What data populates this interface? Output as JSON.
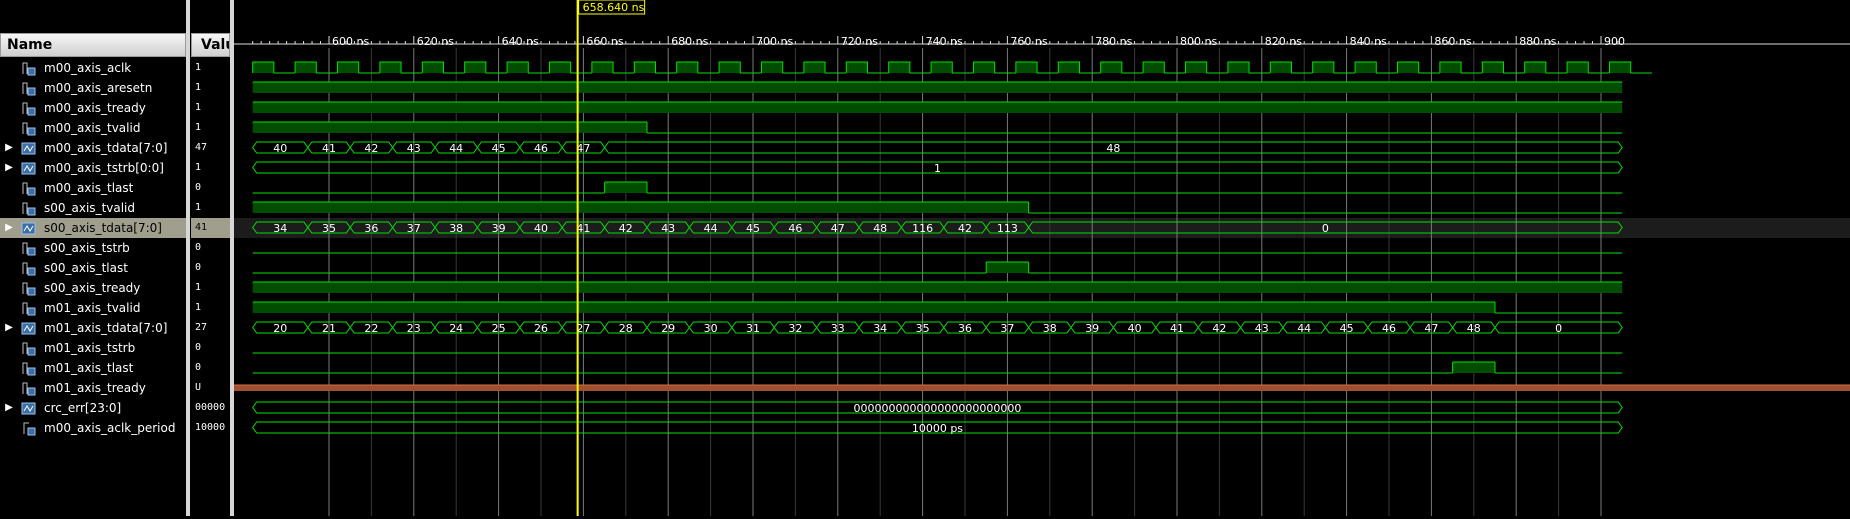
{
  "header": {
    "name_label": "Name",
    "value_label": "Value"
  },
  "cursor": {
    "time_ns": 658.64,
    "label": "658.640 ns"
  },
  "timeline": {
    "tick_labels": [
      {
        "t": 600,
        "label": "600 ns"
      },
      {
        "t": 620,
        "label": "620 ns"
      },
      {
        "t": 640,
        "label": "640 ns"
      },
      {
        "t": 660,
        "label": "660 ns"
      },
      {
        "t": 680,
        "label": "680 ns"
      },
      {
        "t": 700,
        "label": "700 ns"
      },
      {
        "t": 720,
        "label": "720 ns"
      },
      {
        "t": 740,
        "label": "740 ns"
      },
      {
        "t": 760,
        "label": "760 ns"
      },
      {
        "t": 780,
        "label": "780 ns"
      },
      {
        "t": 800,
        "label": "800 ns"
      },
      {
        "t": 820,
        "label": "820 ns"
      },
      {
        "t": 840,
        "label": "840 ns"
      },
      {
        "t": 860,
        "label": "860 ns"
      },
      {
        "t": 880,
        "label": "880 ns"
      },
      {
        "t": 900,
        "label": "900"
      }
    ]
  },
  "colors": {
    "wave": "#00e000",
    "fill": "#004d00",
    "cursor": "#ffff00",
    "undefined": "#a05030",
    "selected": "#a09e8d"
  },
  "signals": [
    {
      "name": "m00_axis_aclk",
      "value": "1",
      "type": "clock",
      "icon": "logic-signal-icon",
      "expandable": false
    },
    {
      "name": "m00_axis_aresetn",
      "value": "1",
      "type": "bit",
      "icon": "logic-signal-icon",
      "expandable": false,
      "segments": [
        {
          "from": 582,
          "to": 905,
          "v": 1
        }
      ]
    },
    {
      "name": "m00_axis_tready",
      "value": "1",
      "type": "bit",
      "icon": "logic-signal-icon",
      "expandable": false,
      "segments": [
        {
          "from": 582,
          "to": 905,
          "v": 1
        }
      ]
    },
    {
      "name": "m00_axis_tvalid",
      "value": "1",
      "type": "bit",
      "icon": "logic-signal-icon",
      "expandable": false,
      "segments": [
        {
          "from": 582,
          "to": 675,
          "v": 1
        },
        {
          "from": 675,
          "to": 905,
          "v": 0
        }
      ]
    },
    {
      "name": "m00_axis_tdata[7:0]",
      "value": "47",
      "type": "bus",
      "icon": "bus-signal-icon",
      "expandable": true,
      "segments": [
        {
          "from": 582,
          "to": 595,
          "v": "40"
        },
        {
          "from": 595,
          "to": 605,
          "v": "41"
        },
        {
          "from": 605,
          "to": 615,
          "v": "42"
        },
        {
          "from": 615,
          "to": 625,
          "v": "43"
        },
        {
          "from": 625,
          "to": 635,
          "v": "44"
        },
        {
          "from": 635,
          "to": 645,
          "v": "45"
        },
        {
          "from": 645,
          "to": 655,
          "v": "46"
        },
        {
          "from": 655,
          "to": 665,
          "v": "47"
        },
        {
          "from": 665,
          "to": 905,
          "v": "48"
        }
      ]
    },
    {
      "name": "m00_axis_tstrb[0:0]",
      "value": "1",
      "type": "bus",
      "icon": "bus-signal-icon",
      "expandable": true,
      "segments": [
        {
          "from": 582,
          "to": 905,
          "v": "1"
        }
      ]
    },
    {
      "name": "m00_axis_tlast",
      "value": "0",
      "type": "bit",
      "icon": "logic-signal-icon",
      "expandable": false,
      "segments": [
        {
          "from": 582,
          "to": 665,
          "v": 0
        },
        {
          "from": 665,
          "to": 675,
          "v": 1
        },
        {
          "from": 675,
          "to": 905,
          "v": 0
        }
      ]
    },
    {
      "name": "s00_axis_tvalid",
      "value": "1",
      "type": "bit",
      "icon": "logic-signal-icon",
      "expandable": false,
      "segments": [
        {
          "from": 582,
          "to": 765,
          "v": 1
        },
        {
          "from": 765,
          "to": 905,
          "v": 0
        }
      ]
    },
    {
      "name": "s00_axis_tdata[7:0]",
      "value": "41",
      "type": "bus",
      "icon": "bus-signal-icon",
      "expandable": true,
      "selected": true,
      "segments": [
        {
          "from": 582,
          "to": 595,
          "v": "34"
        },
        {
          "from": 595,
          "to": 605,
          "v": "35"
        },
        {
          "from": 605,
          "to": 615,
          "v": "36"
        },
        {
          "from": 615,
          "to": 625,
          "v": "37"
        },
        {
          "from": 625,
          "to": 635,
          "v": "38"
        },
        {
          "from": 635,
          "to": 645,
          "v": "39"
        },
        {
          "from": 645,
          "to": 655,
          "v": "40"
        },
        {
          "from": 655,
          "to": 665,
          "v": "41"
        },
        {
          "from": 665,
          "to": 675,
          "v": "42"
        },
        {
          "from": 675,
          "to": 685,
          "v": "43"
        },
        {
          "from": 685,
          "to": 695,
          "v": "44"
        },
        {
          "from": 695,
          "to": 705,
          "v": "45"
        },
        {
          "from": 705,
          "to": 715,
          "v": "46"
        },
        {
          "from": 715,
          "to": 725,
          "v": "47"
        },
        {
          "from": 725,
          "to": 735,
          "v": "48"
        },
        {
          "from": 735,
          "to": 745,
          "v": "116"
        },
        {
          "from": 745,
          "to": 755,
          "v": "42"
        },
        {
          "from": 755,
          "to": 765,
          "v": "113"
        },
        {
          "from": 765,
          "to": 905,
          "v": "0"
        }
      ]
    },
    {
      "name": "s00_axis_tstrb",
      "value": "0",
      "type": "bit",
      "icon": "logic-signal-icon",
      "expandable": false,
      "segments": [
        {
          "from": 582,
          "to": 905,
          "v": 0
        }
      ]
    },
    {
      "name": "s00_axis_tlast",
      "value": "0",
      "type": "bit",
      "icon": "logic-signal-icon",
      "expandable": false,
      "segments": [
        {
          "from": 582,
          "to": 755,
          "v": 0
        },
        {
          "from": 755,
          "to": 765,
          "v": 1
        },
        {
          "from": 765,
          "to": 905,
          "v": 0
        }
      ]
    },
    {
      "name": "s00_axis_tready",
      "value": "1",
      "type": "bit",
      "icon": "logic-signal-icon",
      "expandable": false,
      "segments": [
        {
          "from": 582,
          "to": 905,
          "v": 1
        }
      ]
    },
    {
      "name": "m01_axis_tvalid",
      "value": "1",
      "type": "bit",
      "icon": "logic-signal-icon",
      "expandable": false,
      "segments": [
        {
          "from": 582,
          "to": 875,
          "v": 1
        },
        {
          "from": 875,
          "to": 905,
          "v": 0
        }
      ]
    },
    {
      "name": "m01_axis_tdata[7:0]",
      "value": "27",
      "type": "bus",
      "icon": "bus-signal-icon",
      "expandable": true,
      "segments": [
        {
          "from": 582,
          "to": 595,
          "v": "20"
        },
        {
          "from": 595,
          "to": 605,
          "v": "21"
        },
        {
          "from": 605,
          "to": 615,
          "v": "22"
        },
        {
          "from": 615,
          "to": 625,
          "v": "23"
        },
        {
          "from": 625,
          "to": 635,
          "v": "24"
        },
        {
          "from": 635,
          "to": 645,
          "v": "25"
        },
        {
          "from": 645,
          "to": 655,
          "v": "26"
        },
        {
          "from": 655,
          "to": 665,
          "v": "27"
        },
        {
          "from": 665,
          "to": 675,
          "v": "28"
        },
        {
          "from": 675,
          "to": 685,
          "v": "29"
        },
        {
          "from": 685,
          "to": 695,
          "v": "30"
        },
        {
          "from": 695,
          "to": 705,
          "v": "31"
        },
        {
          "from": 705,
          "to": 715,
          "v": "32"
        },
        {
          "from": 715,
          "to": 725,
          "v": "33"
        },
        {
          "from": 725,
          "to": 735,
          "v": "34"
        },
        {
          "from": 735,
          "to": 745,
          "v": "35"
        },
        {
          "from": 745,
          "to": 755,
          "v": "36"
        },
        {
          "from": 755,
          "to": 765,
          "v": "37"
        },
        {
          "from": 765,
          "to": 775,
          "v": "38"
        },
        {
          "from": 775,
          "to": 785,
          "v": "39"
        },
        {
          "from": 785,
          "to": 795,
          "v": "40"
        },
        {
          "from": 795,
          "to": 805,
          "v": "41"
        },
        {
          "from": 805,
          "to": 815,
          "v": "42"
        },
        {
          "from": 815,
          "to": 825,
          "v": "43"
        },
        {
          "from": 825,
          "to": 835,
          "v": "44"
        },
        {
          "from": 835,
          "to": 845,
          "v": "45"
        },
        {
          "from": 845,
          "to": 855,
          "v": "46"
        },
        {
          "from": 855,
          "to": 865,
          "v": "47"
        },
        {
          "from": 865,
          "to": 875,
          "v": "48"
        },
        {
          "from": 875,
          "to": 905,
          "v": "0"
        }
      ]
    },
    {
      "name": "m01_axis_tstrb",
      "value": "0",
      "type": "bit",
      "icon": "logic-signal-icon",
      "expandable": false,
      "segments": [
        {
          "from": 582,
          "to": 905,
          "v": 0
        }
      ]
    },
    {
      "name": "m01_axis_tlast",
      "value": "0",
      "type": "bit",
      "icon": "logic-signal-icon",
      "expandable": false,
      "segments": [
        {
          "from": 582,
          "to": 865,
          "v": 0
        },
        {
          "from": 865,
          "to": 875,
          "v": 1
        },
        {
          "from": 875,
          "to": 905,
          "v": 0
        }
      ]
    },
    {
      "name": "m01_axis_tready",
      "value": "U",
      "type": "undefined",
      "icon": "logic-signal-icon",
      "expandable": false,
      "segments": [
        {
          "from": 582,
          "to": 905,
          "v": "U"
        }
      ]
    },
    {
      "name": "crc_err[23:0]",
      "value": "00000",
      "type": "bus",
      "icon": "bus-signal-icon",
      "expandable": true,
      "segments": [
        {
          "from": 582,
          "to": 905,
          "v": "000000000000000000000000"
        }
      ]
    },
    {
      "name": "m00_axis_aclk_period",
      "value": "10000",
      "type": "bus",
      "icon": "parameter-icon",
      "expandable": false,
      "segments": [
        {
          "from": 582,
          "to": 905,
          "v": "10000 ps"
        }
      ]
    }
  ]
}
